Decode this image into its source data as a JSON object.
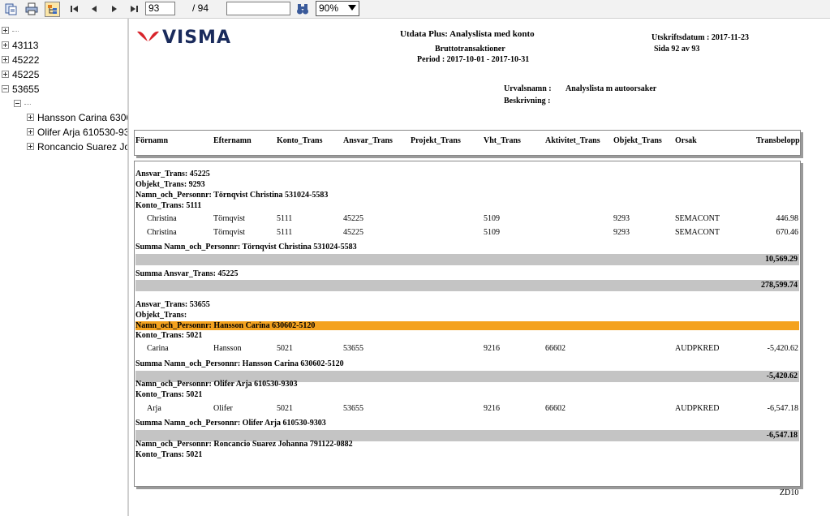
{
  "toolbar": {
    "page_input": "93",
    "page_total": "/ 94",
    "search_value": "",
    "zoom": "90%",
    "icons": [
      "export-icon",
      "print-icon",
      "group-tree-icon",
      "first-page-icon",
      "prev-page-icon",
      "next-page-icon",
      "last-page-icon",
      "binoculars-icon"
    ]
  },
  "tree": {
    "root": "",
    "nodes": [
      "43113",
      "45222",
      "45225",
      "53655"
    ],
    "sub_blank": "",
    "children": [
      "Hansson Carina 630602-5120",
      "Olifer Arja 610530-9303",
      "Roncancio Suarez Johanna 791122-0882"
    ]
  },
  "report": {
    "logo": "VISMA",
    "title": "Utdata Plus: Analyslista med konto",
    "subtitle": "Bruttotransaktioner",
    "period": "Period : 2017-10-01 - 2017-10-31",
    "print_date": "Utskriftsdatum : 2017-11-23",
    "page": "Sida 92 av 93",
    "urval_label": "Urvalsnamn :",
    "urval_value": "Analyslista m autoorsaker",
    "beskrivning_label": "Beskrivning :",
    "columns": [
      "Förnamn",
      "Efternamn",
      "Konto_Trans",
      "Ansvar_Trans",
      "Projekt_Trans",
      "Vht_Trans",
      "Aktivitet_Trans",
      "Objekt_Trans",
      "Orsak",
      "Transbelopp"
    ],
    "g1": {
      "ansvar": "Ansvar_Trans: 45225",
      "objekt": "Objekt_Trans: 9293",
      "namn": "Namn_och_Personnr: Törnqvist Christina 531024-5583",
      "konto": "Konto_Trans: 5111",
      "rows": [
        [
          "Christina",
          "Törnqvist",
          "5111",
          "45225",
          "",
          "5109",
          "",
          "9293",
          "SEMACONT",
          "446.98"
        ],
        [
          "Christina",
          "Törnqvist",
          "5111",
          "45225",
          "",
          "5109",
          "",
          "9293",
          "SEMACONT",
          "670.46"
        ]
      ],
      "summa_namn": "Summa Namn_och_Personnr: Törnqvist Christina 531024-5583",
      "summa_namn_value": "10,569.29",
      "summa_ansvar": "Summa Ansvar_Trans: 45225",
      "summa_ansvar_value": "278,599.74"
    },
    "g2": {
      "ansvar": "Ansvar_Trans: 53655",
      "objekt": "Objekt_Trans:",
      "namn1": "Namn_och_Personnr: Hansson Carina 630602-5120",
      "konto1": "Konto_Trans: 5021",
      "row1": [
        "Carina",
        "Hansson",
        "5021",
        "53655",
        "",
        "9216",
        "66602",
        "",
        "AUDPKRED",
        "-5,420.62"
      ],
      "summa1": "Summa Namn_och_Personnr: Hansson Carina 630602-5120",
      "summa1_value": "-5,420.62",
      "namn2": "Namn_och_Personnr: Olifer Arja 610530-9303",
      "konto2": "Konto_Trans: 5021",
      "row2": [
        "Arja",
        "Olifer",
        "5021",
        "53655",
        "",
        "9216",
        "66602",
        "",
        "AUDPKRED",
        "-6,547.18"
      ],
      "summa2": "Summa Namn_och_Personnr: Olifer Arja 610530-9303",
      "summa2_value": "-6,547.18",
      "namn3": "Namn_och_Personnr: Roncancio Suarez Johanna 791122-0882",
      "konto3": "Konto_Trans: 5021"
    },
    "footer": "ZD10"
  }
}
